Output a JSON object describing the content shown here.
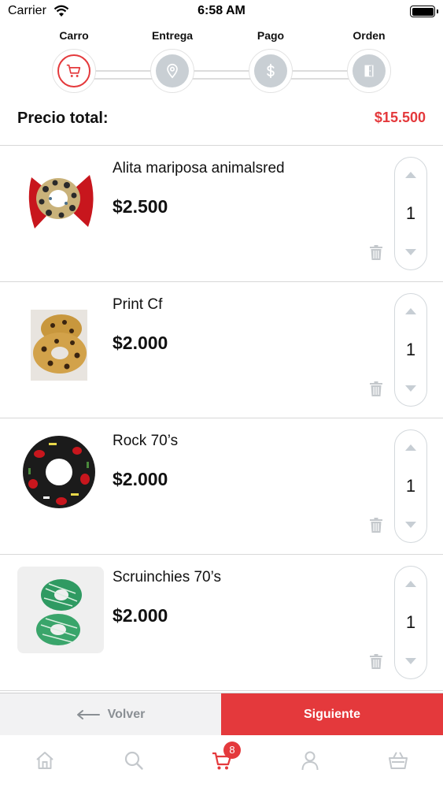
{
  "status_bar": {
    "carrier": "Carrier",
    "time": "6:58 AM"
  },
  "stepper": {
    "steps": [
      {
        "label": "Carro",
        "icon": "cart-icon",
        "active": true
      },
      {
        "label": "Entrega",
        "icon": "location-pin-icon",
        "active": false
      },
      {
        "label": "Pago",
        "icon": "dollar-icon",
        "active": false
      },
      {
        "label": "Orden",
        "icon": "order-door-icon",
        "active": false
      }
    ]
  },
  "total": {
    "label": "Precio total:",
    "value": "$15.500"
  },
  "cart": {
    "items": [
      {
        "name": "Alita mariposa animalsred",
        "price": "$2.500",
        "quantity": "1",
        "image": "bow-scrunchie-red-leopard"
      },
      {
        "name": "Print Cf",
        "price": "$2.000",
        "quantity": "1",
        "image": "scrunchie-leopard-pair"
      },
      {
        "name": "Rock 70’s",
        "price": "$2.000",
        "quantity": "1",
        "image": "scrunchie-black-print"
      },
      {
        "name": "Scruinchies 70’s",
        "price": "$2.000",
        "quantity": "1",
        "image": "scrunchie-green-pair"
      }
    ]
  },
  "actions": {
    "back_label": "Volver",
    "next_label": "Siguiente"
  },
  "tabbar": {
    "items": [
      "home-icon",
      "search-icon",
      "cart-icon",
      "user-icon",
      "basket-icon"
    ],
    "cart_badge": "8"
  },
  "colors": {
    "accent": "#e4393c",
    "inactive": "#c9cfd4"
  }
}
